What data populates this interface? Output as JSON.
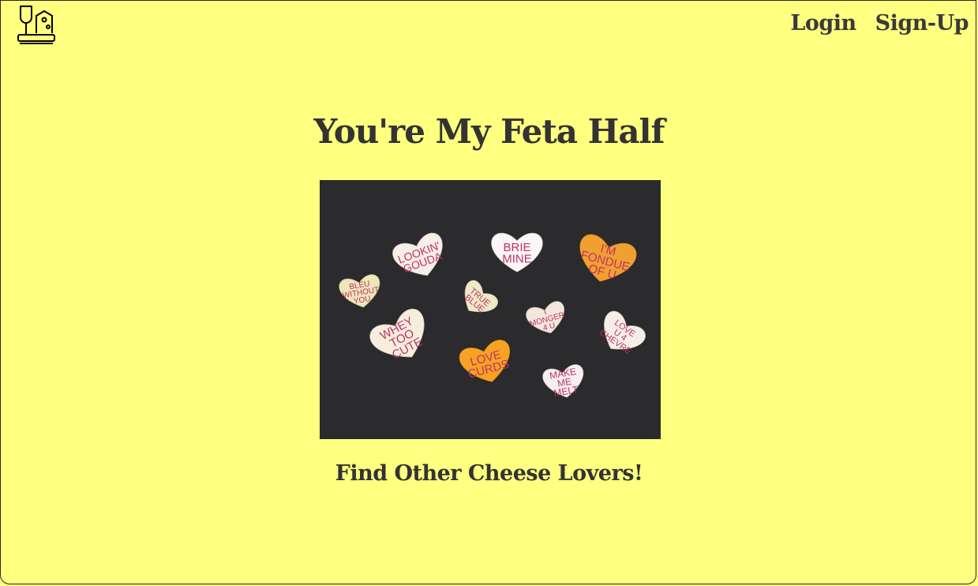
{
  "nav": {
    "login": "Login",
    "signup": "Sign-Up"
  },
  "hero": {
    "heading": "You're My Feta Half",
    "cta": "Find Other Cheese Lovers!",
    "hearts": [
      {
        "text": "BLEU\nWITHOUT\nYOU",
        "fill": "#ece6b8",
        "ink": "#c2306a"
      },
      {
        "text": "LOOKIN'\nGOUDA",
        "fill": "#f6efe6",
        "ink": "#c2306a"
      },
      {
        "text": "BRIE\nMINE",
        "fill": "#fbf6f7",
        "ink": "#c2306a"
      },
      {
        "text": "I'M\nFONDUE\nOF U",
        "fill": "#f0a030",
        "ink": "#c2306a"
      },
      {
        "text": "TRUE\nBLUE",
        "fill": "#eee9c8",
        "ink": "#c2306a"
      },
      {
        "text": "WHEY\nTOO\nCUTE",
        "fill": "#f5eedd",
        "ink": "#c2306a"
      },
      {
        "text": "I\nMONGER\n4 U",
        "fill": "#f3e6dc",
        "ink": "#c2306a"
      },
      {
        "text": "LOVE\nU 4\nCHEVRE",
        "fill": "#f4efe6",
        "ink": "#c2306a"
      },
      {
        "text": "LOVE\nCURDS",
        "fill": "#f7a224",
        "ink": "#c2306a"
      },
      {
        "text": "MAKE\nME\nMELT",
        "fill": "#f7eef0",
        "ink": "#c2306a"
      }
    ],
    "background": "#2b2b2d"
  },
  "colors": {
    "page": "#ffff80",
    "text": "#333333"
  }
}
